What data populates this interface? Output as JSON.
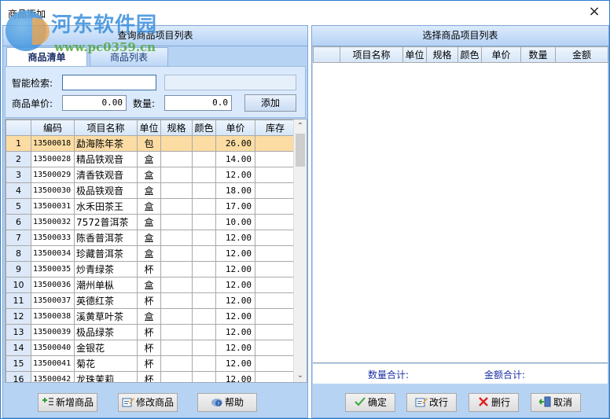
{
  "window": {
    "title": "商品添加",
    "close_icon": "×"
  },
  "watermark": {
    "name": "河东软件园",
    "url": "www.pc0359.cn"
  },
  "left_panel": {
    "header": "查询商品项目列表",
    "tabs": [
      {
        "label": "商品清单",
        "active": true
      },
      {
        "label": "商品列表",
        "active": false
      }
    ],
    "form": {
      "search_label": "智能检索:",
      "search_value": "",
      "search_hint": "",
      "price_label": "商品单价:",
      "price_value": "0.00",
      "qty_label": "数量:",
      "qty_value": "0.0",
      "add_button": "添加"
    },
    "grid": {
      "columns": [
        "",
        "编码",
        "项目名称",
        "单位",
        "规格",
        "颜色",
        "单价",
        "库存"
      ],
      "rows": [
        {
          "no": "1",
          "code": "13500018",
          "name": "勐海陈年茶",
          "unit": "包",
          "spec": "",
          "color": "",
          "price": "26.00",
          "stock": "",
          "selected": true
        },
        {
          "no": "2",
          "code": "13500028",
          "name": "精品铁观音",
          "unit": "盒",
          "spec": "",
          "color": "",
          "price": "14.00",
          "stock": ""
        },
        {
          "no": "3",
          "code": "13500029",
          "name": "清香铁观音",
          "unit": "盒",
          "spec": "",
          "color": "",
          "price": "12.00",
          "stock": ""
        },
        {
          "no": "4",
          "code": "13500030",
          "name": "极品铁观音",
          "unit": "盒",
          "spec": "",
          "color": "",
          "price": "18.00",
          "stock": ""
        },
        {
          "no": "5",
          "code": "13500031",
          "name": "水禾田茶王",
          "unit": "盒",
          "spec": "",
          "color": "",
          "price": "17.00",
          "stock": ""
        },
        {
          "no": "6",
          "code": "13500032",
          "name": "7572普洱茶",
          "unit": "盒",
          "spec": "",
          "color": "",
          "price": "10.00",
          "stock": ""
        },
        {
          "no": "7",
          "code": "13500033",
          "name": "陈香普洱茶",
          "unit": "盒",
          "spec": "",
          "color": "",
          "price": "12.00",
          "stock": ""
        },
        {
          "no": "8",
          "code": "13500034",
          "name": "珍藏普洱茶",
          "unit": "盒",
          "spec": "",
          "color": "",
          "price": "12.00",
          "stock": ""
        },
        {
          "no": "9",
          "code": "13500035",
          "name": "炒青绿茶",
          "unit": "杯",
          "spec": "",
          "color": "",
          "price": "12.00",
          "stock": ""
        },
        {
          "no": "10",
          "code": "13500036",
          "name": "潮州单枞",
          "unit": "盒",
          "spec": "",
          "color": "",
          "price": "12.00",
          "stock": ""
        },
        {
          "no": "11",
          "code": "13500037",
          "name": "英德红茶",
          "unit": "杯",
          "spec": "",
          "color": "",
          "price": "12.00",
          "stock": ""
        },
        {
          "no": "12",
          "code": "13500038",
          "name": "溪黄草叶茶",
          "unit": "盒",
          "spec": "",
          "color": "",
          "price": "12.00",
          "stock": ""
        },
        {
          "no": "13",
          "code": "13500039",
          "name": "极品绿茶",
          "unit": "杯",
          "spec": "",
          "color": "",
          "price": "12.00",
          "stock": ""
        },
        {
          "no": "14",
          "code": "13500040",
          "name": "金银花",
          "unit": "杯",
          "spec": "",
          "color": "",
          "price": "12.00",
          "stock": ""
        },
        {
          "no": "15",
          "code": "13500041",
          "name": "菊花",
          "unit": "杯",
          "spec": "",
          "color": "",
          "price": "12.00",
          "stock": ""
        },
        {
          "no": "16",
          "code": "13500042",
          "name": "龙珠茉莉",
          "unit": "杯",
          "spec": "",
          "color": "",
          "price": "12.00",
          "stock": ""
        }
      ]
    },
    "buttons": {
      "add_product": "新增商品",
      "edit_product": "修改商品",
      "help": "帮助"
    }
  },
  "right_panel": {
    "header": "选择商品项目列表",
    "grid": {
      "columns": [
        "",
        "项目名称",
        "单位",
        "规格",
        "颜色",
        "单价",
        "数量",
        "金额"
      ],
      "rows": []
    },
    "totals": {
      "qty_label": "数量合计:",
      "amount_label": "金额合计:"
    },
    "buttons": {
      "confirm": "确定",
      "edit_row": "改行",
      "delete_row": "删行",
      "cancel": "取消"
    }
  },
  "colors": {
    "panel_bg": "#b7d3f4",
    "selected_row": "#fbdca3",
    "totals_text": "#1c2fa6"
  }
}
